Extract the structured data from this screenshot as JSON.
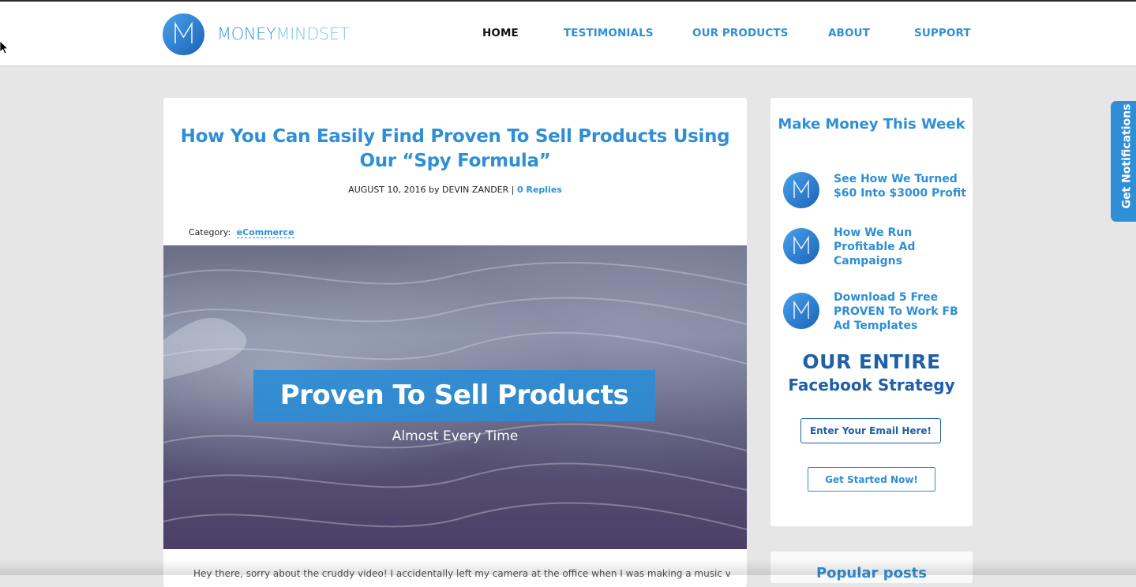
{
  "site": {
    "logo_text_bold": "MONEY",
    "logo_text_light": "MINDSET",
    "logo_icon": "m-letter-circle-icon"
  },
  "nav": {
    "items": [
      {
        "label": "HOME",
        "active": true
      },
      {
        "label": "TESTIMONIALS",
        "active": false
      },
      {
        "label": "OUR PRODUCTS",
        "active": false
      },
      {
        "label": "ABOUT",
        "active": false
      },
      {
        "label": "SUPPORT",
        "active": false
      }
    ]
  },
  "post": {
    "title": "How You Can Easily Find Proven To Sell Products Using Our “Spy Formula”",
    "meta_date_author": "AUGUST 10, 2016 by DEVIN ZANDER",
    "meta_separator": "|",
    "replies": "0  Replies",
    "category_label": "Category:",
    "category_value": "eCommerce",
    "hero_title": "Proven To Sell Products",
    "hero_subtitle": "Almost Every Time",
    "excerpt": "Hey there, sorry about the cruddy video! I accidentally left my camera at the office when I was making a music video for"
  },
  "sidebar": {
    "heading": "Make Money This Week",
    "items": [
      {
        "label": "See How We Turned $60 Into $3000 Profit",
        "icon": "m-letter-circle-icon"
      },
      {
        "label": "How We Run Profitable Ad Campaigns",
        "icon": "m-letter-circle-icon"
      },
      {
        "label": "Download 5 Free PROVEN To Work FB Ad Templates",
        "icon": "m-letter-circle-icon"
      }
    ],
    "strategy_line1": "OUR ENTIRE",
    "strategy_line2": "Facebook Strategy",
    "email_placeholder": "Enter Your Email Here!",
    "cta_label": "Get Started Now!",
    "popular_heading": "Popular posts"
  },
  "notifications": {
    "label": "Get Notifications"
  },
  "colors": {
    "accent": "#2f8fd6",
    "dark_blue": "#1f5fa8",
    "page_bg": "#e6e6e6"
  }
}
